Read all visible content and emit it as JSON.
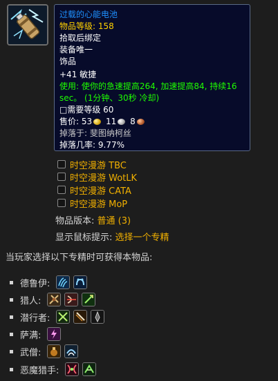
{
  "item": {
    "icon": "charged-battery-icon",
    "name": "过载的心能电池",
    "item_level": "物品等级: 158",
    "binding": "拾取后绑定",
    "unique": "装备唯一",
    "slot": "饰品",
    "stat": "+41 敏捷",
    "use_line1": "使用: 使你的急速提高264, 加速提高84, 持续16",
    "use_line2": "sec。 (1分钟、30秒 冷却)",
    "required_level": "□需要等级 60",
    "sell_price": {
      "label": "售价:",
      "gold": "53",
      "silver": "11",
      "copper": "8"
    },
    "dropped_by": "掉落于: 斐图纳柯丝",
    "drop_rate": "掉落几率: 9.77%",
    "colors": {
      "name": "#1e90ff",
      "item_level": "#ffd100",
      "use": "#1eff00",
      "tooltip_bg": "#070b2a"
    }
  },
  "timewalking": [
    {
      "label": "时空漫游 TBC",
      "checked": false
    },
    {
      "label": "时空漫游 WotLK",
      "checked": false
    },
    {
      "label": "时空漫游 CATA",
      "checked": false
    },
    {
      "label": "时空漫游 MoP",
      "checked": false
    }
  ],
  "version": {
    "label": "物品版本:",
    "value": "普通 (3)"
  },
  "mouse_tip": {
    "label": "显示鼠标提示:",
    "value": "选择一个专精"
  },
  "intro": "当玩家选择以下专精时可获得本物品:",
  "specs": [
    {
      "label": "德鲁伊:",
      "icons": [
        "feral-claw-icon",
        "guardian-bear-icon"
      ]
    },
    {
      "label": "猎人:",
      "icons": [
        "beast-mastery-icon",
        "marksmanship-icon",
        "survival-icon"
      ]
    },
    {
      "label": "潜行者:",
      "icons": [
        "assassination-icon",
        "outlaw-icon",
        "subtlety-icon"
      ]
    },
    {
      "label": "萨满:",
      "icons": [
        "enhancement-icon"
      ]
    },
    {
      "label": "武僧:",
      "icons": [
        "brewmaster-icon",
        "windwalker-icon"
      ]
    },
    {
      "label": "恶魔猎手:",
      "icons": [
        "havoc-icon",
        "vengeance-icon"
      ]
    }
  ]
}
